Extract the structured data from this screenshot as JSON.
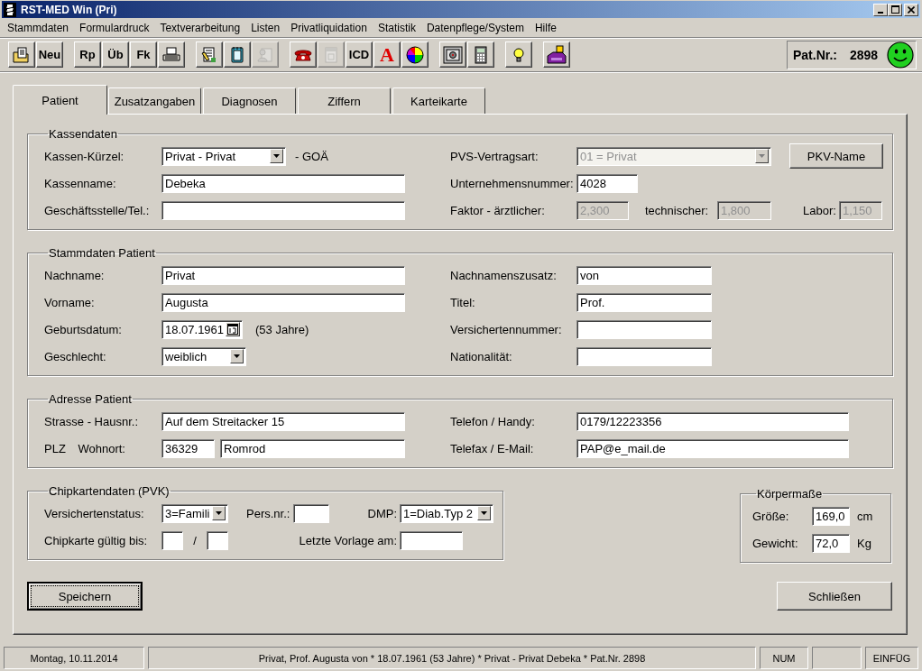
{
  "window": {
    "title": "RST-MED Win (Pri)"
  },
  "menu": [
    "Stammdaten",
    "Formulardruck",
    "Textverarbeitung",
    "Listen",
    "Privatliquidation",
    "Statistik",
    "Datenpflege/System",
    "Hilfe"
  ],
  "toolbar": [
    [
      {
        "kind": "icon",
        "disabled": false
      },
      {
        "kind": "text",
        "label": "Neu",
        "disabled": false
      }
    ],
    [
      {
        "kind": "text",
        "label": "Rp",
        "disabled": false
      },
      {
        "kind": "text",
        "label": "Üb",
        "disabled": false
      },
      {
        "kind": "text",
        "label": "Fk",
        "disabled": false
      },
      {
        "kind": "icon",
        "disabled": false
      }
    ],
    [
      {
        "kind": "icon",
        "disabled": false
      },
      {
        "kind": "icon",
        "disabled": false
      },
      {
        "kind": "icon",
        "disabled": true
      }
    ],
    [
      {
        "kind": "icon",
        "disabled": false
      },
      {
        "kind": "icon",
        "disabled": true
      },
      {
        "kind": "text",
        "label": "ICD",
        "disabled": false
      },
      {
        "kind": "pharmacy",
        "label": "A",
        "disabled": false
      },
      {
        "kind": "icon",
        "disabled": false
      }
    ],
    [
      {
        "kind": "icon",
        "disabled": false
      },
      {
        "kind": "icon",
        "disabled": false
      }
    ],
    [
      {
        "kind": "icon",
        "disabled": false
      }
    ],
    [
      {
        "kind": "icon",
        "disabled": false
      }
    ]
  ],
  "patient_number": {
    "label": "Pat.Nr.:",
    "value": "2898"
  },
  "tabs": [
    {
      "label": "Patient",
      "selected": true
    },
    {
      "label": "Zusatzangaben",
      "selected": false
    },
    {
      "label": "Diagnosen",
      "selected": false
    },
    {
      "label": "Ziffern",
      "selected": false
    },
    {
      "label": "Karteikarte",
      "selected": false
    }
  ],
  "sections": [
    {
      "title": "Kassendaten",
      "rows": [
        [
          {
            "label": "Kassen-Kürzel:",
            "controls": [
              {
                "kind": "combo",
                "value": "Privat - Privat",
                "disabled": false
              },
              {
                "kind": "text",
                "text": "- GOÄ"
              }
            ]
          },
          {
            "label": "PVS-Vertragsart:",
            "controls": [
              {
                "kind": "combo",
                "value": "01 = Privat",
                "disabled": true
              },
              {
                "kind": "button",
                "label": "PKV-Name"
              }
            ]
          }
        ],
        [
          {
            "label": "Kassenname:",
            "controls": [
              {
                "kind": "input",
                "value": "Debeka",
                "disabled": false
              }
            ]
          },
          {
            "label": "Unternehmensnummer:",
            "controls": [
              {
                "kind": "input",
                "value": "4028",
                "disabled": false
              }
            ]
          }
        ],
        [
          {
            "label": "Geschäftsstelle/Tel.:",
            "controls": [
              {
                "kind": "input",
                "disabled": false
              }
            ]
          },
          {
            "label": "Faktor - ärztlicher:",
            "controls": [
              {
                "kind": "input",
                "value": "2,300",
                "disabled": true
              }
            ]
          },
          {
            "label": "technischer:",
            "controls": [
              {
                "kind": "input",
                "value": "1,800",
                "disabled": true
              }
            ]
          },
          {
            "label": "Labor:",
            "controls": [
              {
                "kind": "input",
                "value": "1,150",
                "disabled": true
              }
            ]
          }
        ]
      ]
    },
    {
      "title": "Stammdaten Patient",
      "rows": [
        [
          {
            "label": "Nachname:",
            "controls": [
              {
                "kind": "input",
                "value": "Privat",
                "disabled": false
              }
            ]
          },
          {
            "label": "Nachnamenszusatz:",
            "controls": [
              {
                "kind": "input",
                "value": "von",
                "disabled": false
              }
            ]
          }
        ],
        [
          {
            "label": "Vorname:",
            "controls": [
              {
                "kind": "input",
                "value": "Augusta",
                "disabled": false
              }
            ]
          },
          {
            "label": "Titel:",
            "controls": [
              {
                "kind": "input",
                "value": "Prof.",
                "disabled": false
              }
            ]
          }
        ],
        [
          {
            "label": "Geburtsdatum:",
            "controls": [
              {
                "kind": "date",
                "value": "18.07.1961",
                "disabled": false
              },
              {
                "kind": "text",
                "text": "(53 Jahre)"
              }
            ]
          },
          {
            "label": "Versichertennummer:",
            "controls": [
              {
                "kind": "input",
                "disabled": false
              }
            ]
          }
        ],
        [
          {
            "label": "Geschlecht:",
            "controls": [
              {
                "kind": "combo",
                "value": "weiblich",
                "disabled": false
              }
            ]
          },
          {
            "label": "Nationalität:",
            "controls": [
              {
                "kind": "input",
                "disabled": false
              }
            ]
          }
        ]
      ]
    },
    {
      "title": "Adresse Patient",
      "rows": [
        [
          {
            "label": "Strasse - Hausnr.:",
            "controls": [
              {
                "kind": "input",
                "value": "Auf dem Streitacker 15",
                "disabled": false
              }
            ]
          },
          {
            "label": "Telefon / Handy:",
            "controls": [
              {
                "kind": "input",
                "value": "0179/12223356",
                "disabled": false
              }
            ]
          }
        ],
        [
          {
            "label": "PLZ Wohnort:",
            "controls": [
              {
                "kind": "input",
                "value": "36329",
                "disabled": false
              },
              {
                "kind": "input",
                "value": "Romrod",
                "disabled": false
              }
            ]
          },
          {
            "label": "Telefax / E-Mail:",
            "controls": [
              {
                "kind": "input",
                "value": "PAP@e_mail.de",
                "disabled": false
              }
            ]
          }
        ]
      ]
    }
  ],
  "bottom_sections": [
    {
      "title": "Chipkartendaten (PVK)",
      "rows": [
        [
          {
            "label": "Versichertenstatus:",
            "controls": [
              {
                "kind": "combo",
                "value": "3=Famili",
                "disabled": false
              }
            ]
          },
          {
            "label": "Pers.nr.:",
            "controls": [
              {
                "kind": "input",
                "disabled": false
              }
            ]
          },
          {
            "label": "DMP:",
            "controls": [
              {
                "kind": "combo",
                "value": "1=Diab.Typ 2",
                "disabled": false
              }
            ]
          }
        ],
        [
          {
            "label": "Chipkarte gültig bis:",
            "controls": [
              {
                "kind": "input",
                "disabled": false
              },
              {
                "kind": "text",
                "text": "/"
              },
              {
                "kind": "input",
                "disabled": false
              }
            ]
          },
          {
            "label": "Letzte Vorlage am:",
            "controls": [
              {
                "kind": "input",
                "disabled": false
              }
            ]
          }
        ]
      ]
    },
    {
      "title": "Körpermaße",
      "rows": [
        [
          {
            "label": "Größe:",
            "controls": [
              {
                "kind": "input",
                "value": "169,0",
                "disabled": false
              },
              {
                "kind": "text",
                "text": "cm"
              }
            ]
          }
        ],
        [
          {
            "label": "Gewicht:",
            "controls": [
              {
                "kind": "input",
                "value": "72,0",
                "disabled": false
              },
              {
                "kind": "text",
                "text": "Kg"
              }
            ]
          }
        ]
      ]
    }
  ],
  "buttons": [
    {
      "label": "Speichern",
      "default": true
    },
    {
      "label": "Schließen",
      "default": false
    }
  ],
  "status_bar": [
    {
      "text": "Montag, 10.11.2014"
    },
    {
      "text": "Privat, Prof. Augusta von * 18.07.1961 (53 Jahre)  *  Privat - Privat Debeka  *  Pat.Nr. 2898"
    },
    {
      "text": "NUM"
    },
    {
      "text": "EINFÜG"
    }
  ]
}
